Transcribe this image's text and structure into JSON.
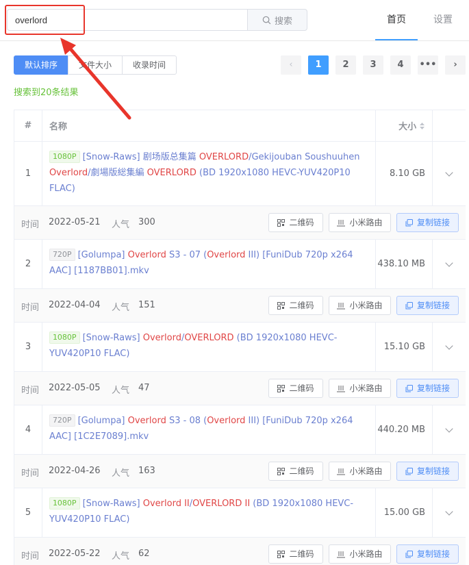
{
  "search": {
    "value": "overlord",
    "button_label": "搜索"
  },
  "nav": {
    "home": "首页",
    "settings": "设置"
  },
  "sort": {
    "default": "默认排序",
    "size": "文件大小",
    "date": "收录时间"
  },
  "pagination": {
    "pages": [
      "1",
      "2",
      "3",
      "4",
      "•••"
    ],
    "active": "1"
  },
  "result_count": "搜索到20条结果",
  "table": {
    "headers": {
      "index": "#",
      "name": "名称",
      "size": "大小"
    },
    "meta_labels": {
      "time": "时间",
      "popularity": "人气"
    },
    "buttons": {
      "qr": "二维码",
      "router": "小米路由",
      "copy": "复制链接"
    },
    "rows": [
      {
        "index": "1",
        "size": "8.10 GB",
        "date": "2022-05-21",
        "popularity": "300",
        "tag": "1080P",
        "tag_color": "green"
      },
      {
        "index": "2",
        "size": "438.10 MB",
        "date": "2022-04-04",
        "popularity": "151",
        "tag": "720P",
        "tag_color": "gray"
      },
      {
        "index": "3",
        "size": "15.10 GB",
        "date": "2022-05-05",
        "popularity": "47",
        "tag": "1080P",
        "tag_color": "green"
      },
      {
        "index": "4",
        "size": "440.20 MB",
        "date": "2022-04-26",
        "popularity": "163",
        "tag": "720P",
        "tag_color": "gray"
      },
      {
        "index": "5",
        "size": "15.00 GB",
        "date": "2022-05-22",
        "popularity": "62",
        "tag": "1080P",
        "tag_color": "green"
      }
    ],
    "titles": {
      "r1": [
        "[Snow-Raws] 剧场版总集篇 ",
        "OVERLORD",
        "/Gekijouban Soushuuhen ",
        "Overlord",
        "/劇場版総集編 ",
        "OVERLORD",
        " (BD 1920x1080 HEVC-YUV420P10 FLAC)"
      ],
      "r2": [
        "[Golumpa] ",
        "Overlord",
        " S3 - 07 (",
        "Overlord",
        " III) [FuniDub 720p x264 AAC] [1187BB01].mkv"
      ],
      "r3": [
        "[Snow-Raws] ",
        "Overlord",
        "/",
        "OVERLORD",
        " (BD 1920x1080 HEVC-YUV420P10 FLAC)"
      ],
      "r4": [
        "[Golumpa] ",
        "Overlord",
        " S3 - 08 (",
        "Overlord",
        " III) [FuniDub 720p x264 AAC] [1C2E7089].mkv"
      ],
      "r5": [
        "[Snow-Raws] ",
        "Overlord II",
        "/",
        "OVERLORD II",
        " (BD 1920x1080 HEVC-YUV420P10 FLAC)"
      ]
    }
  },
  "colors": {
    "accent": "#409eff",
    "keyword": "#e04646",
    "annotation": "#e8352b",
    "success": "#67c23a"
  }
}
